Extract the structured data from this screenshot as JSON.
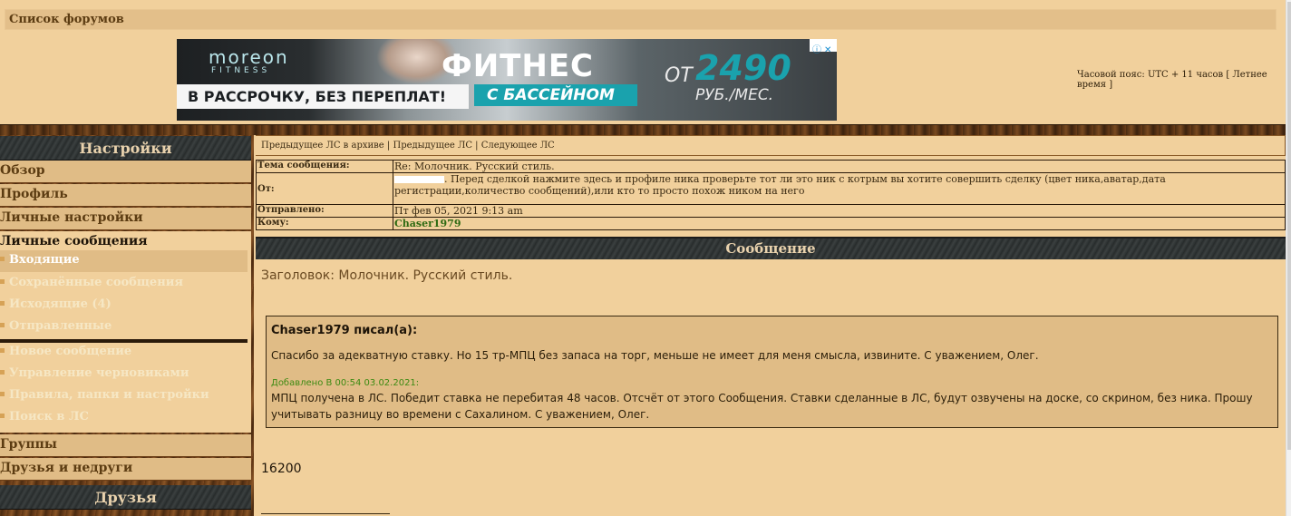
{
  "topbar": {
    "forum_list": "Список форумов"
  },
  "banner": {
    "brand": "moreon",
    "brand_sub": "FITNESS",
    "installment": "В РАССРОЧКУ, БЕЗ ПЕРЕПЛАТ!",
    "headline": "ФИТНЕС",
    "subline": "С БАССЕЙНОМ",
    "from": "ОТ",
    "price": "2490",
    "per": "РУБ./МЕС."
  },
  "timezone": "Часовой пояс: UTC + 11 часов [ Летнее время ]",
  "sidebar": {
    "settings_header": "Настройки",
    "items": [
      {
        "label": "Обзор"
      },
      {
        "label": "Профиль"
      },
      {
        "label": "Личные настройки"
      }
    ],
    "pm_header": "Личные сообщения",
    "pm_items": [
      {
        "label": "Входящие"
      },
      {
        "label": "Сохранённые сообщения"
      },
      {
        "label": "Исходящие (4)"
      },
      {
        "label": "Отправленные"
      }
    ],
    "pm_actions": [
      {
        "label": "Новое сообщение"
      },
      {
        "label": "Управление черновиками"
      },
      {
        "label": "Правила, папки и настройки"
      },
      {
        "label": "Поиск в ЛС"
      }
    ],
    "groups": "Группы",
    "friends_foes": "Друзья и недруги",
    "friends_header": "Друзья"
  },
  "nav": {
    "prev_archive": "Предыдущее ЛС в архиве",
    "prev": "Предыдущее ЛС",
    "next": "Следующее ЛС",
    "sep": "|"
  },
  "header": {
    "subject_label": "Тема сообщения:",
    "subject_value": "Re: Молочник. Русский стиль.",
    "from_label": "От:",
    "from_value": ". Перед сделкой нажмите здесь и профиле ника проверьте тот ли это ник с котрым вы хотите совершить сделку (цвет ника,аватар,дата регистрации,количество сообщений),или кто то просто похож ником на него",
    "sent_label": "Отправлено:",
    "sent_value": "Пт фев 05, 2021 9:13 am",
    "to_label": "Кому:",
    "to_value": "Chaser1979"
  },
  "message": {
    "header": "Сообщение",
    "title": "Заголовок: Молочник. Русский стиль.",
    "quote_author": "Chaser1979 писал(а):",
    "quote_text1": "Спасибо за адекватную ставку. Но 15 тр-МПЦ без запаса на торг, меньше не имеет для меня смысла, извините. С уважением, Олег.",
    "added": "Добавлено В 00:54 03.02.2021:",
    "quote_text2": "МПЦ получена в ЛС. Победит ставка не перебитая 48 часов. Отсчёт от этого Сообщения. Ставки сделанные в ЛС, будут озвучены на доске, со скрином, без ника. Прошу учитывать разницу во времени с Сахалином. С уважением, Олег.",
    "amount": "16200"
  }
}
